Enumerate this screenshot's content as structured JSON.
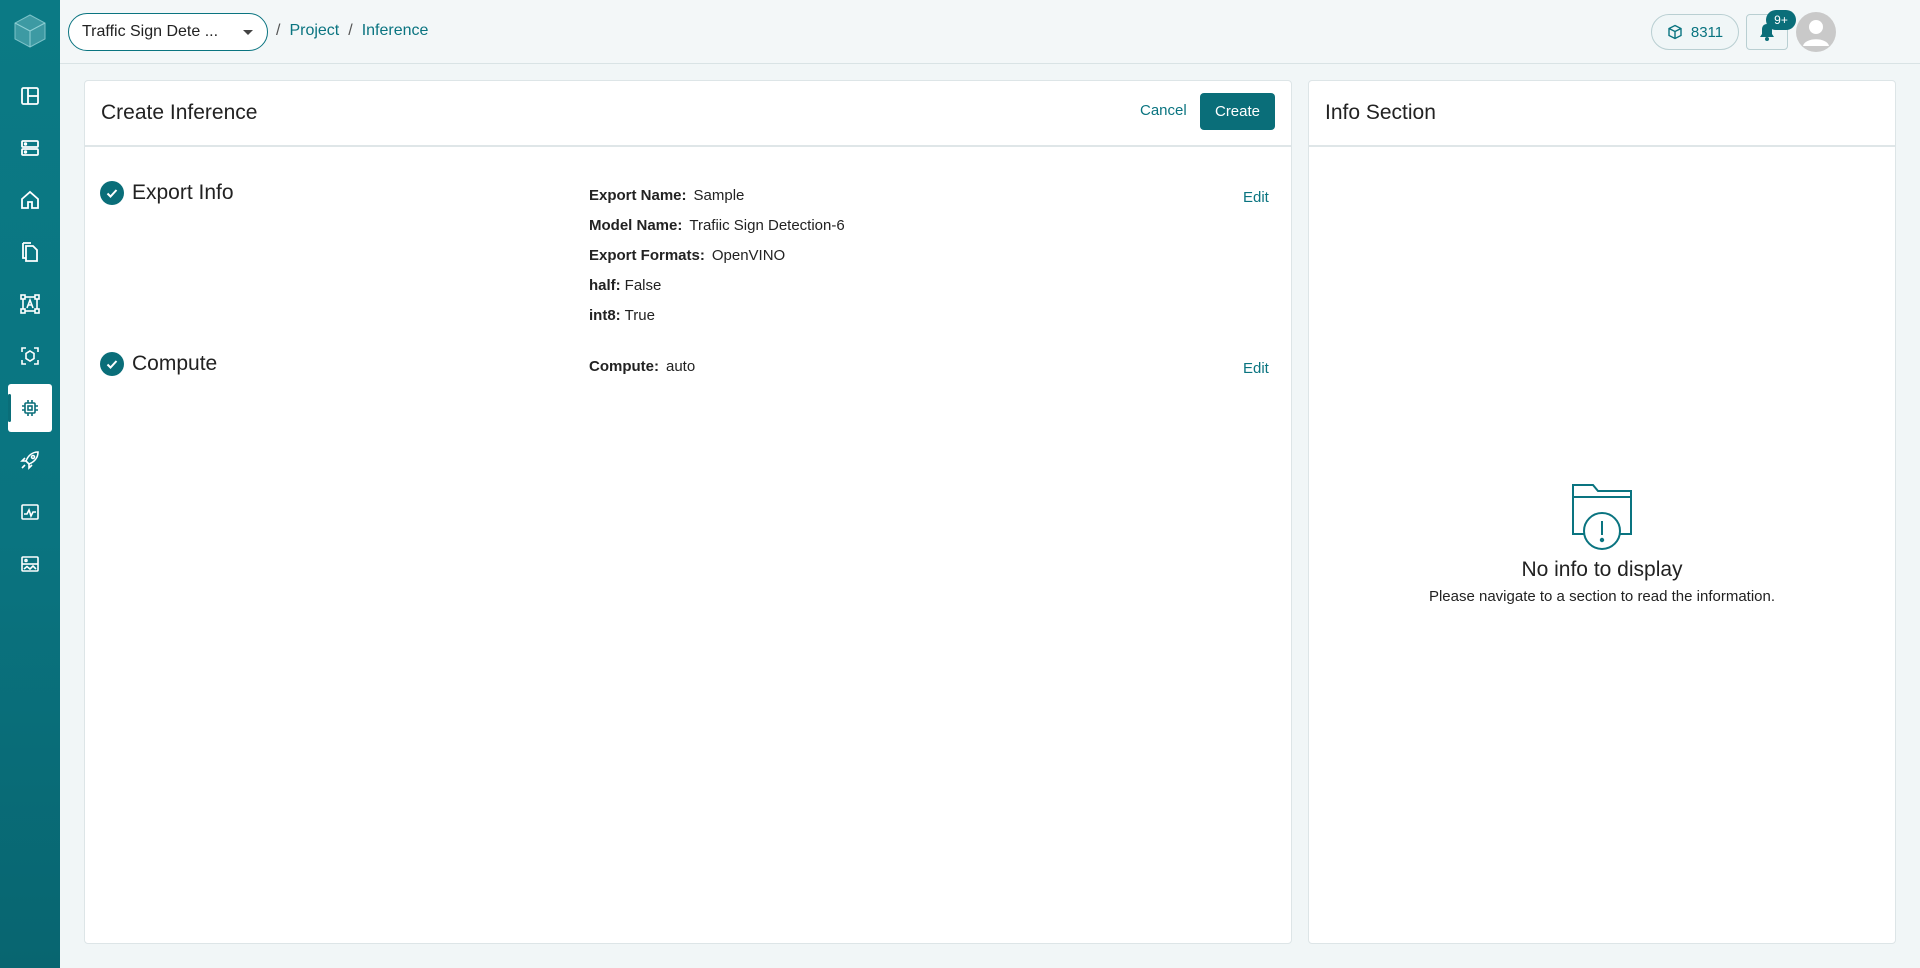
{
  "sidebar": {
    "items": [
      {
        "icon": "dashboard-icon"
      },
      {
        "icon": "storage-icon"
      },
      {
        "icon": "home-icon"
      },
      {
        "icon": "documents-icon"
      },
      {
        "icon": "annotation-icon"
      },
      {
        "icon": "model-icon"
      },
      {
        "icon": "chip-icon",
        "active": true
      },
      {
        "icon": "rocket-icon"
      },
      {
        "icon": "monitor-icon"
      },
      {
        "icon": "dataset-icon"
      }
    ]
  },
  "header": {
    "project_select": "Traffic Sign Dete ...",
    "breadcrumb": [
      "Project",
      "Inference"
    ],
    "credits": "8311",
    "notifications_badge": "9+"
  },
  "main": {
    "title": "Create Inference",
    "cancel_label": "Cancel",
    "create_label": "Create",
    "sections": {
      "export": {
        "title": "Export Info",
        "edit_label": "Edit",
        "fields": [
          {
            "label": "Export Name:",
            "value": "Sample"
          },
          {
            "label": "Model Name:",
            "value": "Trafiic Sign Detection-6"
          },
          {
            "label": "Export Formats:",
            "value": "OpenVINO"
          },
          {
            "label": "half:",
            "value": "False"
          },
          {
            "label": "int8:",
            "value": "True"
          }
        ]
      },
      "compute": {
        "title": "Compute",
        "edit_label": "Edit",
        "fields": [
          {
            "label": "Compute:",
            "value": "auto"
          }
        ]
      }
    }
  },
  "info": {
    "title": "Info Section",
    "empty_title": "No info to display",
    "empty_subtitle": "Please navigate to a section to read the information."
  },
  "colors": {
    "accent": "#0a7480",
    "sidebar": "#0a7480"
  }
}
